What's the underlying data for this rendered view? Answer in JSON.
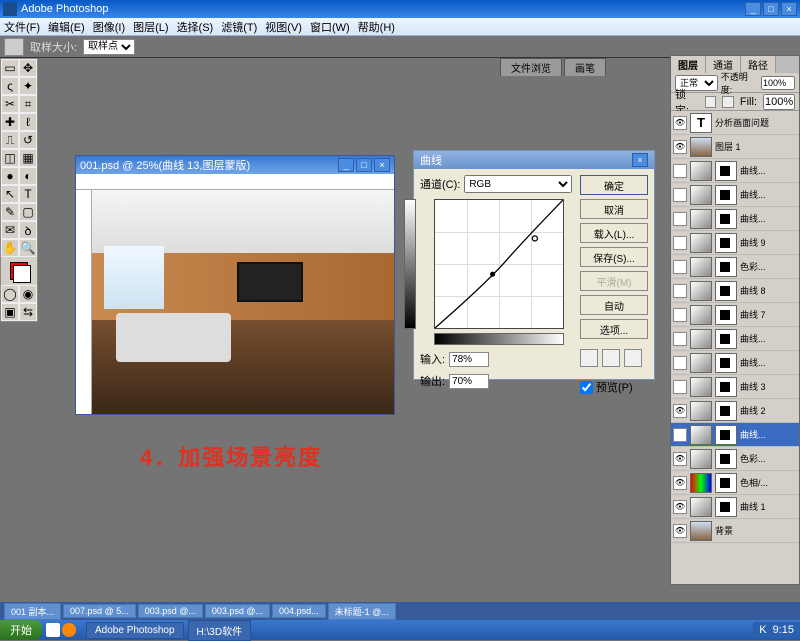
{
  "app": {
    "title": "Adobe Photoshop"
  },
  "menu": [
    "文件(F)",
    "编辑(E)",
    "图像(I)",
    "图层(L)",
    "选择(S)",
    "滤镜(T)",
    "视图(V)",
    "窗口(W)",
    "帮助(H)"
  ],
  "optbar": {
    "label": "取样大小:",
    "value": "取样点"
  },
  "opt_tabs": [
    "文件浏览",
    "画笔"
  ],
  "doc": {
    "title": "001.psd @ 25%(曲线 13,图层蒙版)"
  },
  "caption": "4．加强场景亮度",
  "curves": {
    "title": "曲线",
    "channel_label": "通道(C):",
    "channel": "RGB",
    "input_label": "输入:",
    "input": "78%",
    "output_label": "输出:",
    "output": "70%",
    "buttons": {
      "ok": "确定",
      "cancel": "取消",
      "load": "载入(L)...",
      "save": "保存(S)...",
      "smooth": "平滑(M)",
      "auto": "自动",
      "options": "选项..."
    },
    "preview": "预览(P)"
  },
  "chart_data": {
    "type": "line",
    "title": "曲线",
    "x": [
      0,
      0.45,
      0.78,
      1.0
    ],
    "y": [
      0,
      0.42,
      0.7,
      1.0
    ],
    "xlabel": "输入",
    "ylabel": "输出",
    "xlim": [
      0,
      1
    ],
    "ylim": [
      0,
      1
    ]
  },
  "layers_panel": {
    "tabs": [
      "图层",
      "通道",
      "路径"
    ],
    "blend": "正常",
    "opacity_label": "不透明度:",
    "opacity": "100%",
    "lock_label": "锁定:",
    "fill_label": "Fill:",
    "fill": "100%",
    "items": [
      {
        "name": "分析画面问题",
        "kind": "txt",
        "vis": true
      },
      {
        "name": "图层 1",
        "kind": "img",
        "vis": true
      },
      {
        "name": "曲线...",
        "kind": "grad",
        "mask": true,
        "vis": false
      },
      {
        "name": "曲线...",
        "kind": "grad",
        "mask": true,
        "vis": false
      },
      {
        "name": "曲线...",
        "kind": "grad",
        "mask": true,
        "vis": false
      },
      {
        "name": "曲线 9",
        "kind": "grad",
        "mask": true,
        "vis": false
      },
      {
        "name": "色彩...",
        "kind": "grad",
        "mask": true,
        "vis": false
      },
      {
        "name": "曲线 8",
        "kind": "grad",
        "mask": true,
        "vis": false
      },
      {
        "name": "曲线 7",
        "kind": "grad",
        "mask": true,
        "vis": false
      },
      {
        "name": "曲线...",
        "kind": "grad",
        "mask": true,
        "vis": false
      },
      {
        "name": "曲线...",
        "kind": "grad",
        "mask": true,
        "vis": false
      },
      {
        "name": "曲线 3",
        "kind": "grad",
        "mask": true,
        "vis": false
      },
      {
        "name": "曲线 2",
        "kind": "grad",
        "mask": true,
        "vis": true
      },
      {
        "name": "曲线...",
        "kind": "grad",
        "mask": true,
        "vis": true,
        "sel": true
      },
      {
        "name": "色彩...",
        "kind": "grad",
        "mask": true,
        "vis": true
      },
      {
        "name": "色相/...",
        "kind": "hue",
        "mask": true,
        "vis": true
      },
      {
        "name": "曲线 1",
        "kind": "grad",
        "mask": true,
        "vis": true
      },
      {
        "name": "背景",
        "kind": "img",
        "vis": true
      }
    ]
  },
  "tasktabs": [
    "001 副本...",
    "007.psd @ 5...",
    "003.psd @...",
    "003.psd @...",
    "004.psd...",
    "未标题-1 @..."
  ],
  "taskbar": {
    "start": "开始",
    "tasks": [
      "Adobe Photoshop",
      "H:\\3D软件"
    ],
    "time": "9:15"
  }
}
